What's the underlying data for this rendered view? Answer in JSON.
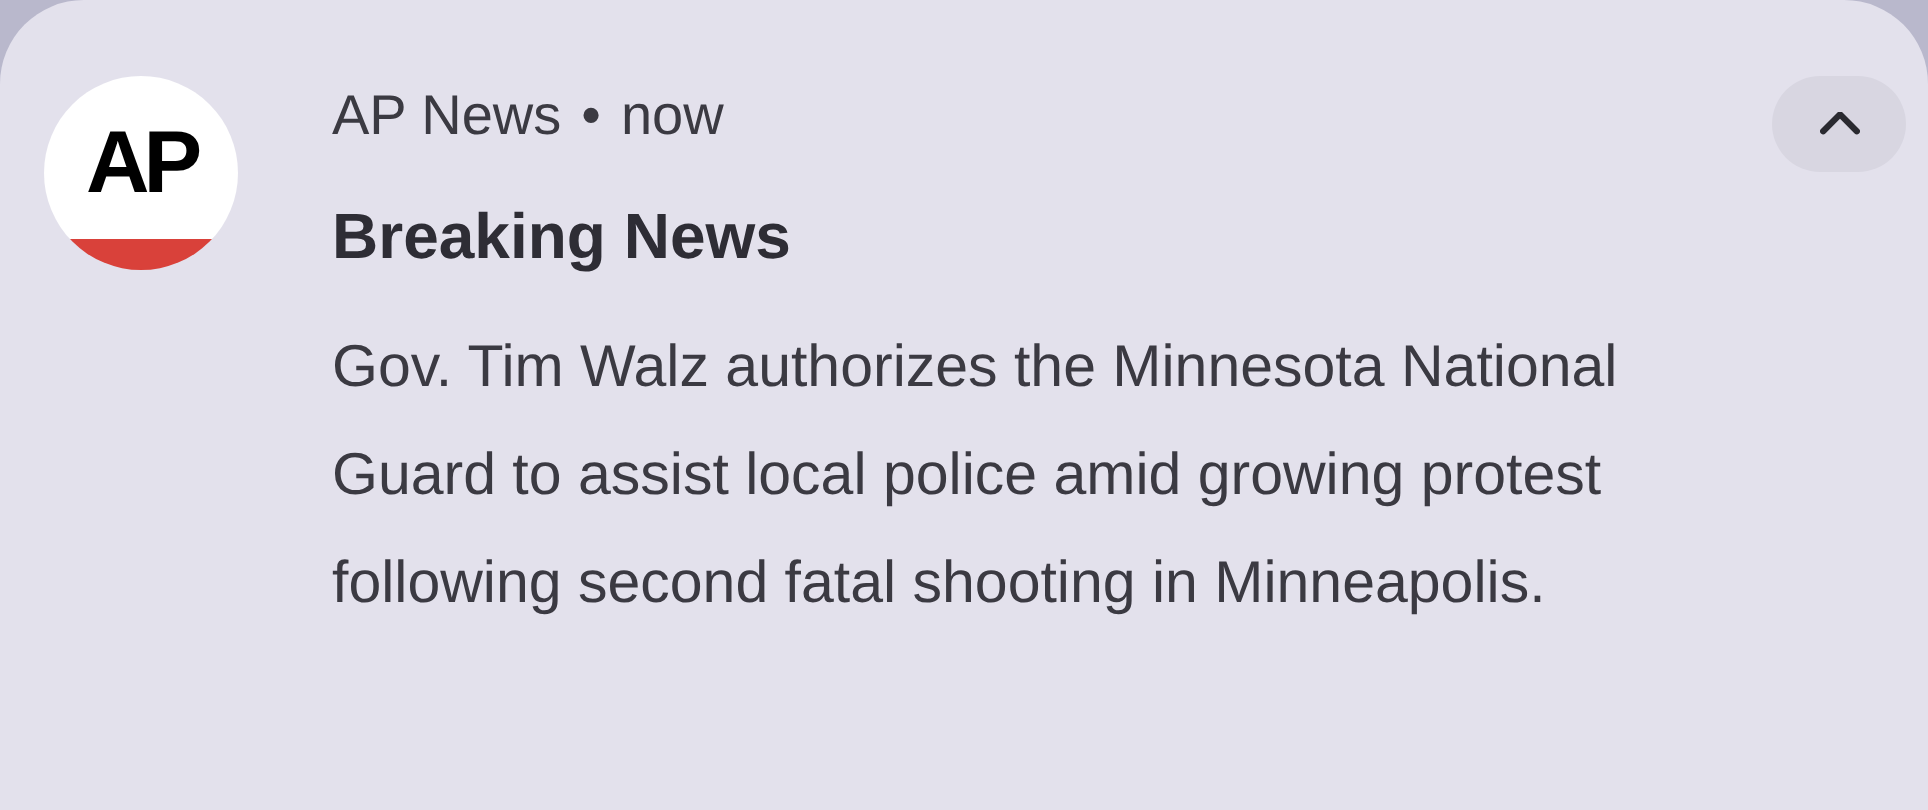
{
  "notification": {
    "logo_text": "AP",
    "app_name": "AP News",
    "separator": "•",
    "time": "now",
    "expanded": true,
    "title": "Breaking News",
    "body": "Gov. Tim Walz authorizes the Minnesota National Guard to assist local police amid growing protest following second fatal shooting in Minneapolis."
  }
}
